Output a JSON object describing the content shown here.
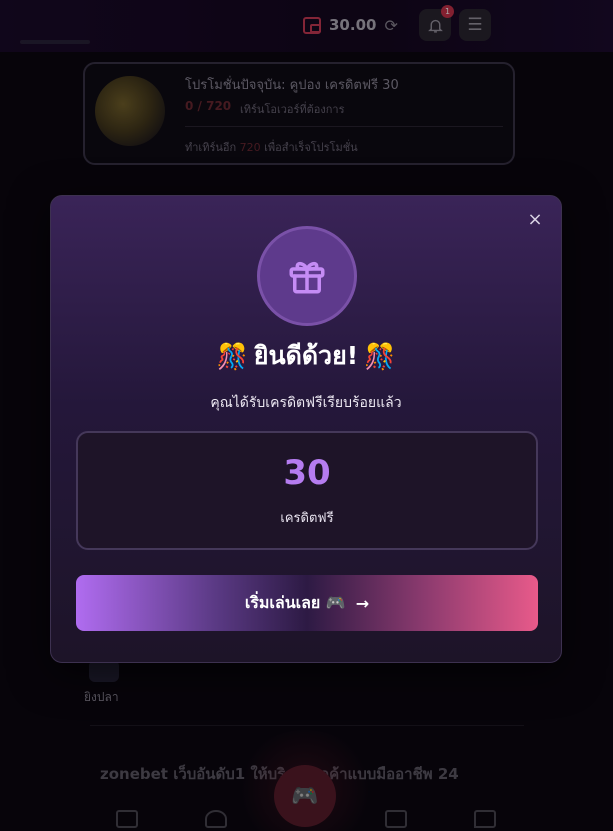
{
  "header": {
    "balance": "30.00",
    "notification_count": "1"
  },
  "promo": {
    "title": "โปรโมชั่นปัจจุบัน:  คูปอง เครดิตฟรี 30",
    "progress": "0 / 720",
    "progress_note": "เทิร์นโอเวอร์ที่ต้องการ",
    "remaining_prefix": "ทำเทิร์นอีก ",
    "remaining_value": "720",
    "remaining_suffix": " เพื่อสำเร็จโปรโมชั่น"
  },
  "games": {
    "fish_label": "ยิงปลา"
  },
  "footer": {
    "tagline": "zonebet เว็บอันดับ1 ให้บริการลูกค้าแบบมืออาชีพ 24"
  },
  "modal": {
    "close_label": "×",
    "headline": "ยินดีด้วย!",
    "headline_emoji": "🎊",
    "subtitle": "คุณได้รับเครดิตฟรีเรียบร้อยแล้ว",
    "credit_amount": "30",
    "credit_label": "เครดิตฟรี",
    "play_label": "เริ่มเล่นเลย 🎮",
    "play_arrow": "→"
  },
  "colors": {
    "accent_purple": "#b57cf0",
    "accent_pink": "#e85a8a",
    "modal_bg": "#2a1a40"
  }
}
